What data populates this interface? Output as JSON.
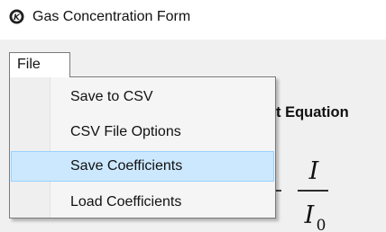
{
  "window": {
    "title": "Gas Concentration Form",
    "icon": "app-logo-icon"
  },
  "menubar": {
    "file_label": "File"
  },
  "file_menu": {
    "items": [
      {
        "label": "Save to CSV"
      },
      {
        "label": "CSV File Options"
      },
      {
        "label": "Save Coefficients",
        "highlighted": true
      },
      {
        "label": "Load Coefficients"
      }
    ]
  },
  "form": {
    "heading_partial": "t Equation",
    "equation": {
      "numerator": "I",
      "denominator": "I",
      "denominator_subscript": "0"
    }
  },
  "colors": {
    "highlight_fill": "#cce8ff",
    "highlight_border": "#99d1ff",
    "menu_background": "#f5f5f5",
    "client_background": "#f0f0f0"
  }
}
